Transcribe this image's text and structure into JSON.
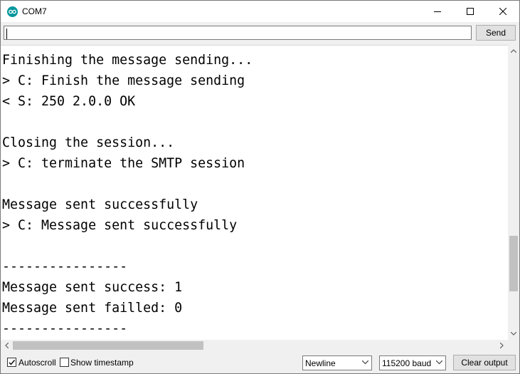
{
  "window": {
    "title": "COM7"
  },
  "toolbar": {
    "input_value": "",
    "send_label": "Send"
  },
  "console": {
    "lines": [
      "Finishing the message sending...",
      "> C: Finish the message sending",
      "< S: 250 2.0.0 OK",
      "",
      "Closing the session...",
      "> C: terminate the SMTP session",
      "",
      "Message sent successfully",
      "> C: Message sent successfully",
      "",
      "----------------",
      "Message sent success: 1",
      "Message sent failled: 0",
      "----------------"
    ]
  },
  "statusbar": {
    "autoscroll_label": "Autoscroll",
    "autoscroll_checked": true,
    "timestamp_label": "Show timestamp",
    "timestamp_checked": false,
    "line_ending": "Newline",
    "baud_rate": "115200 baud",
    "clear_label": "Clear output"
  },
  "icons": {
    "app": "arduino-icon",
    "minimize": "minimize-icon",
    "maximize": "maximize-icon",
    "close": "close-icon"
  },
  "colors": {
    "app_icon": "#00979c",
    "console_bg": "#ffffff",
    "chrome_bg": "#f0f0f0"
  }
}
